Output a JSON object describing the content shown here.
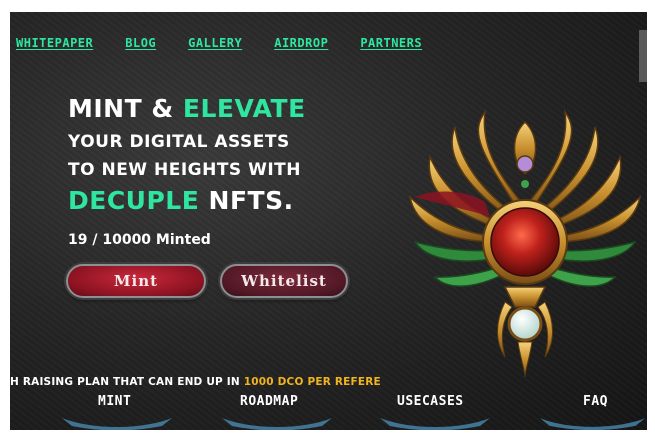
{
  "nav": {
    "items": [
      "WHITEPAPER",
      "BLOG",
      "GALLERY",
      "AIRDROP",
      "PARTNERS"
    ]
  },
  "hero": {
    "line1_white": "MINT &",
    "line1_green": "ELEVATE",
    "line2": "YOUR DIGITAL ASSETS",
    "line3": "TO NEW HEIGHTS WITH",
    "line4_green": "DECUPLE",
    "line4_white": "NFTS.",
    "minted": "19 / 10000 Minted"
  },
  "buttons": {
    "mint": "Mint",
    "whitelist": "Whitelist"
  },
  "ticker": {
    "text_white": "H RAISING PLAN THAT CAN END UP IN ",
    "text_gold": "1000 DCO PER REFERE"
  },
  "bottom_nav": {
    "items": [
      "MINT",
      "ROADMAP",
      "USECASES",
      "FAQ"
    ]
  },
  "colors": {
    "accent_green": "#2fe6a0",
    "ticker_gold": "#f0b420",
    "mint_button": "#b21f33",
    "whitelist_button": "#6a2232",
    "background": "#262626"
  },
  "icons": {
    "emblem": "winged-gem-emblem-icon"
  }
}
